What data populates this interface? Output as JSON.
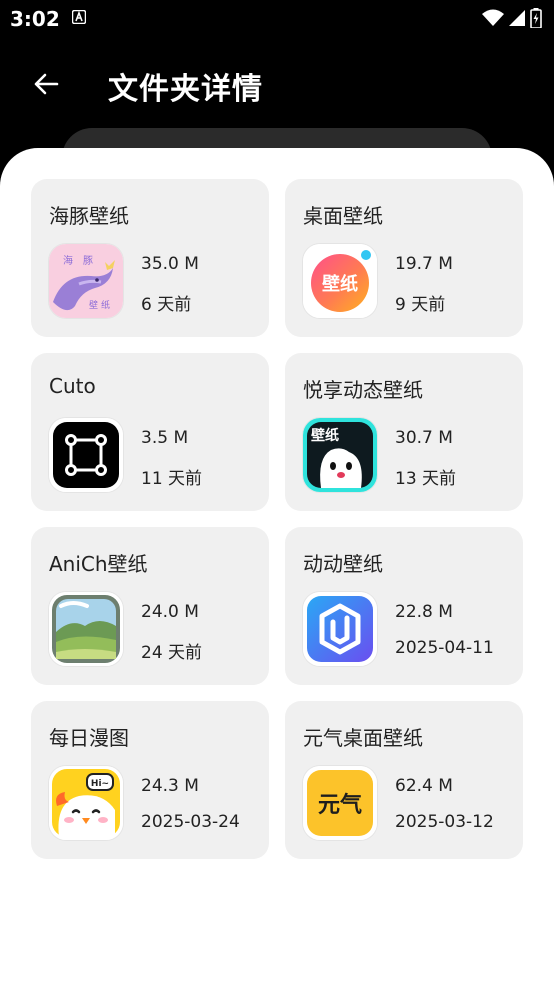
{
  "status_bar": {
    "time": "3:02"
  },
  "header": {
    "title": "文件夹详情"
  },
  "folders": [
    {
      "name": "海豚壁纸",
      "size": "35.0 M",
      "date": "6 天前",
      "icon": "dolphin-wallpaper-app-icon",
      "icon_text": [
        "海",
        "豚",
        "壁",
        "纸"
      ]
    },
    {
      "name": "桌面壁纸",
      "size": "19.7 M",
      "date": "9 天前",
      "icon": "desktop-wallpaper-app-icon",
      "icon_text": [
        "壁纸"
      ]
    },
    {
      "name": "Cuto",
      "size": "3.5 M",
      "date": "11 天前",
      "icon": "cuto-app-icon"
    },
    {
      "name": "悦享动态壁纸",
      "size": "30.7 M",
      "date": "13 天前",
      "icon": "yuexiang-live-wallpaper-app-icon",
      "icon_text": [
        "壁纸"
      ]
    },
    {
      "name": "AniCh壁纸",
      "size": "24.0 M",
      "date": "24 天前",
      "icon": "anich-wallpaper-app-icon"
    },
    {
      "name": "动动壁纸",
      "size": "22.8 M",
      "date": "2025-04-11",
      "icon": "dongdong-wallpaper-app-icon"
    },
    {
      "name": "每日漫图",
      "size": "24.3 M",
      "date": "2025-03-24",
      "icon": "daily-comic-app-icon",
      "icon_text": [
        "Hi~"
      ]
    },
    {
      "name": "元气桌面壁纸",
      "size": "62.4 M",
      "date": "2025-03-12",
      "icon": "yuanqi-desktop-wallpaper-app-icon",
      "icon_text": [
        "元气"
      ]
    }
  ]
}
